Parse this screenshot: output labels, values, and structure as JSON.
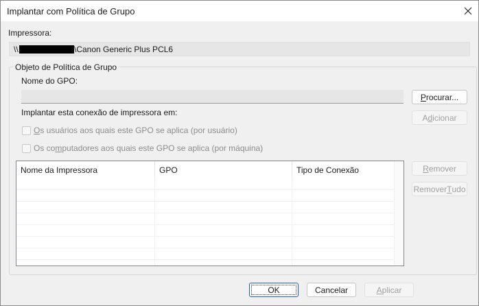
{
  "window": {
    "title": "Implantar com Política de Grupo"
  },
  "printer": {
    "label": "Impressora:",
    "prefix": "\\\\",
    "suffix": "\\Canon Generic Plus PCL6"
  },
  "group": {
    "legend": "Objeto de Política de Grupo",
    "gpo_name_label": "Nome do GPO:",
    "gpo_name_value": "",
    "browse_button": {
      "pre": "",
      "key": "P",
      "post": "rocurar..."
    },
    "deploy_label": "Implantar esta conexão de impressora em:",
    "add_button": {
      "pre": "A",
      "key": "d",
      "post": "icionar"
    },
    "users_check": {
      "pre": "",
      "key": "O",
      "post": "s usuários aos quais este GPO se aplica (por usuário)",
      "checked": false
    },
    "computers_check": {
      "pre": "Os co",
      "key": "m",
      "post": "putadores aos quais este GPO se aplica (por máquina)",
      "checked": false
    }
  },
  "table": {
    "columns": [
      "Nome da Impressora",
      "GPO",
      "Tipo de Conexão"
    ],
    "rows": []
  },
  "side_buttons": {
    "remove": {
      "pre": "",
      "key": "R",
      "post": "emover"
    },
    "remove_all": {
      "pre": "Remover ",
      "key": "T",
      "post": "udo"
    }
  },
  "footer": {
    "ok": "OK",
    "cancel": "Cancelar",
    "apply": {
      "pre": "",
      "key": "A",
      "post": "plicar"
    }
  },
  "colors": {
    "accent": "#1b5ab5",
    "disabled_text": "#a0a0a0"
  }
}
